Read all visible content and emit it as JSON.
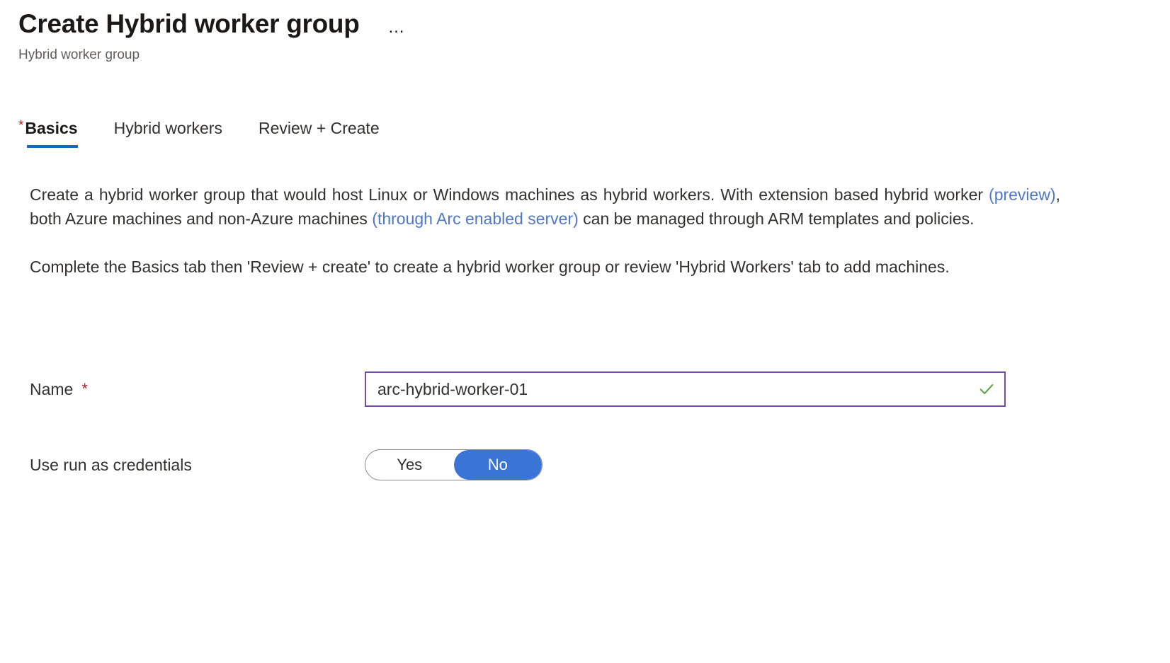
{
  "header": {
    "title": "Create Hybrid worker group",
    "subtitle": "Hybrid worker group",
    "more_menu": "…"
  },
  "tabs": [
    {
      "label": "Basics",
      "required": true,
      "active": true
    },
    {
      "label": "Hybrid workers",
      "required": false,
      "active": false
    },
    {
      "label": "Review + Create",
      "required": false,
      "active": false
    }
  ],
  "description": {
    "paragraph1_part1": "Create a hybrid worker group that would host Linux or Windows machines as hybrid workers. With extension based hybrid worker ",
    "link_preview": "(preview)",
    "paragraph1_part2": ", both Azure machines and non-Azure machines ",
    "link_arc": "(through Arc enabled server)",
    "paragraph1_part3": " can be managed through ARM templates and policies.",
    "paragraph2": "Complete the Basics tab then 'Review + create' to create a hybrid worker group or review 'Hybrid Workers' tab to add machines."
  },
  "form": {
    "name": {
      "label": "Name",
      "required_marker": "*",
      "value": "arc-hybrid-worker-01",
      "placeholder": "",
      "validation_icon": "checkmark-icon",
      "validation_color": "#5a9e3f",
      "border_color": "#744da9"
    },
    "run_as_credentials": {
      "label": "Use run as credentials",
      "options": [
        "Yes",
        "No"
      ],
      "selected": "No",
      "selected_color": "#3a74d4"
    }
  },
  "theme": {
    "accent": "#0f6cbd",
    "required_star": "#a4262c",
    "link": "#4f77c8",
    "text": "#323130",
    "muted_text": "#605e5c"
  }
}
